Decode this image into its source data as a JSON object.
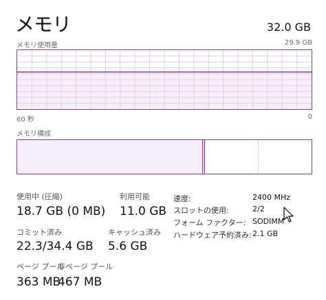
{
  "header": {
    "title": "メモリ",
    "total": "32.0 GB"
  },
  "usage_graph": {
    "label": "メモリ使用量",
    "max_label": "29.9 GB",
    "time_left": "60 秒",
    "time_right": "0",
    "usage_fraction": 0.63
  },
  "composition": {
    "label": "メモリ構成",
    "in_use_fraction": 0.632,
    "modified_fraction": 0.005,
    "standby_fraction": 0.184
  },
  "stats": {
    "in_use_label": "使用中 (圧縮)",
    "in_use_value": "18.7 GB (0 MB)",
    "available_label": "利用可能",
    "available_value": "11.0 GB",
    "committed_label": "コミット済み",
    "committed_value": "22.3/34.4 GB",
    "cached_label": "キャッシュ済み",
    "cached_value": "5.6 GB",
    "paged_label": "ページ プール",
    "paged_value": "363 MB",
    "nonpaged_label": "非ページ プール",
    "nonpaged_value": "467 MB"
  },
  "details": {
    "speed_label": "速度:",
    "speed_value": "2400 MHz",
    "slots_label": "スロットの使用:",
    "slots_value": "2/2",
    "form_label": "フォーム ファクター:",
    "form_value": "SODIMM",
    "reserved_label": "ハードウェア予約済み:",
    "reserved_value": "2.1 GB"
  },
  "colors": {
    "accent": "#8b3a97",
    "fill": "#f6eef8",
    "grid": "#e2cfe6"
  }
}
